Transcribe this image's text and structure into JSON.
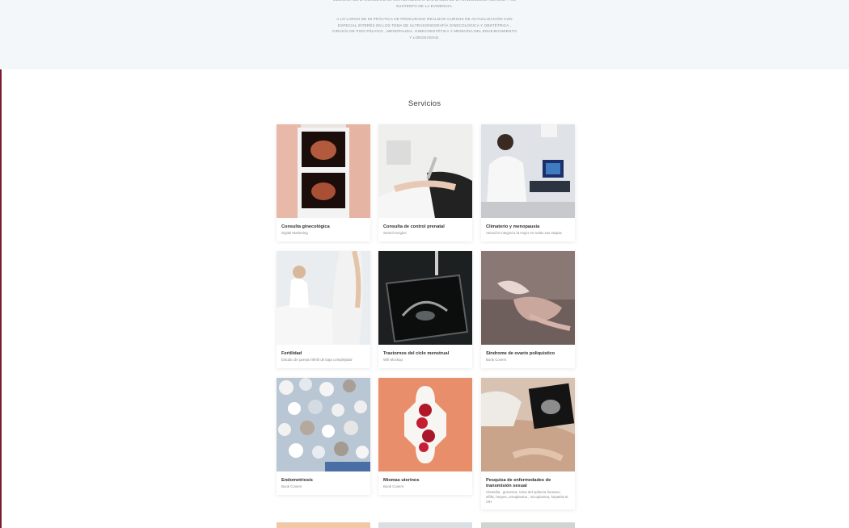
{
  "intro": {
    "paragraph1": "MEDICINA DE LA LONGEVIDAD, SIN ABANDONAR LAS BASES DE LA GINECOLOGÍA CLÁSICA Y EL SUSTENTO DE LA EVIDENCIA.",
    "paragraph2": "A LO LARGO DE MI PRÁCTICA HE PROCURADO REALIZAR CURSOS DE ACTUALIZACIÓN CON ESPECIAL INTERÉS EN LOS TEMA DE ULTRASONOGRAFÍA GINECOLÓGICA Y OBSTÉTRICA , CIRUGÍA DE PISO PÉLVICO , MENOPAUSIA, GINECOESTÉTICA Y MEDICINA DEL ENVEJECIMIENTO Y LONGEVIDAD."
  },
  "services": {
    "title": "Servicios",
    "items": [
      {
        "title": "Consulta ginecológica",
        "subtitle": "Digital Marketing"
      },
      {
        "title": "Consulta de control prenatal",
        "subtitle": "Search Engine"
      },
      {
        "title": "Climaterio y menopausia",
        "subtitle": "Atención integral a la mujer en todas sus etapas"
      },
      {
        "title": "Fertilidad",
        "subtitle": "Estudio de pareja infértil de baja complejidad"
      },
      {
        "title": "Trastornos del ciclo menstrual",
        "subtitle": "Wifi Mockup"
      },
      {
        "title": "Síndrome de ovario poliquístico",
        "subtitle": "Book Covers"
      },
      {
        "title": "Endometriosis",
        "subtitle": "Book Covers"
      },
      {
        "title": "Miomas uterinos",
        "subtitle": "Book Covers"
      },
      {
        "title": "Pesquisa de enfermedades de transmisión sexual",
        "subtitle": "Clamidia , gonorrea, Virus del epiloma humano, sífilis, herpes, ureaplasma , micoplasma, hepatitis B, VIH"
      }
    ]
  },
  "colors": {
    "intro_bg": "#f4f7fa",
    "accent_edge": "#7a1c33"
  }
}
